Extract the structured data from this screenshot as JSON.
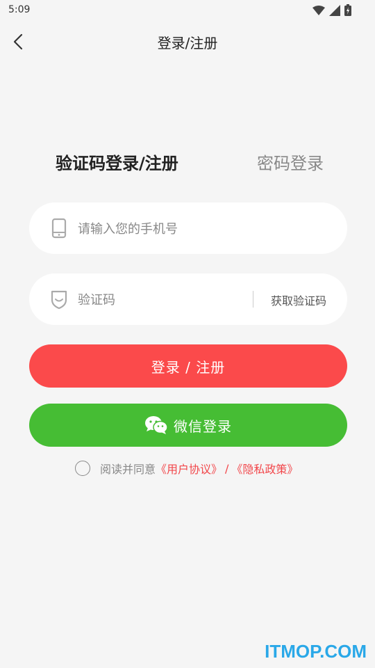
{
  "status_bar": {
    "time": "5:09",
    "icons": [
      "wifi-icon",
      "signal-icon",
      "battery-icon"
    ]
  },
  "header": {
    "title": "登录/注册",
    "back_icon": "back-arrow-icon"
  },
  "tabs": {
    "code_login": "验证码登录/注册",
    "password_login": "密码登录"
  },
  "form": {
    "phone_placeholder": "请输入您的手机号",
    "phone_icon": "phone-icon",
    "code_placeholder": "验证码",
    "code_icon": "shield-icon",
    "get_code_label": "获取验证码"
  },
  "buttons": {
    "login_label": "登录 / 注册",
    "wechat_label": "微信登录",
    "wechat_icon": "wechat-icon"
  },
  "agreement": {
    "prefix": "阅读并同意",
    "user_agreement": "《用户协议》",
    "separator": "/",
    "privacy_policy": "《隐私政策》"
  },
  "watermark": "ITMOP.COM",
  "colors": {
    "background": "#f5f5f5",
    "login_button": "#fb4a4b",
    "wechat_button": "#46bd34",
    "link": "#f2464a",
    "watermark": "#2aa8e8"
  }
}
